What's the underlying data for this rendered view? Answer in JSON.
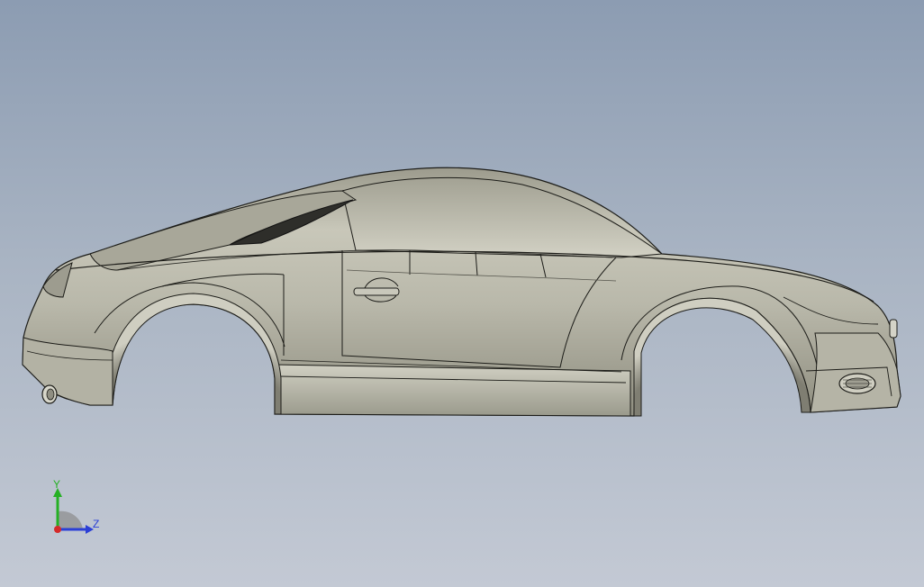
{
  "viewport": {
    "model": "car-body",
    "view": "side"
  },
  "triad": {
    "y_label": "Y",
    "z_label": "Z",
    "colors": {
      "y": "#25b024",
      "z": "#2b3fd6",
      "x": "#d42a2a"
    }
  },
  "colors": {
    "background_top": "#8c9cb2",
    "background_bottom": "#c3c9d4",
    "body": "#bdbcae",
    "edge": "#1c1c18"
  }
}
